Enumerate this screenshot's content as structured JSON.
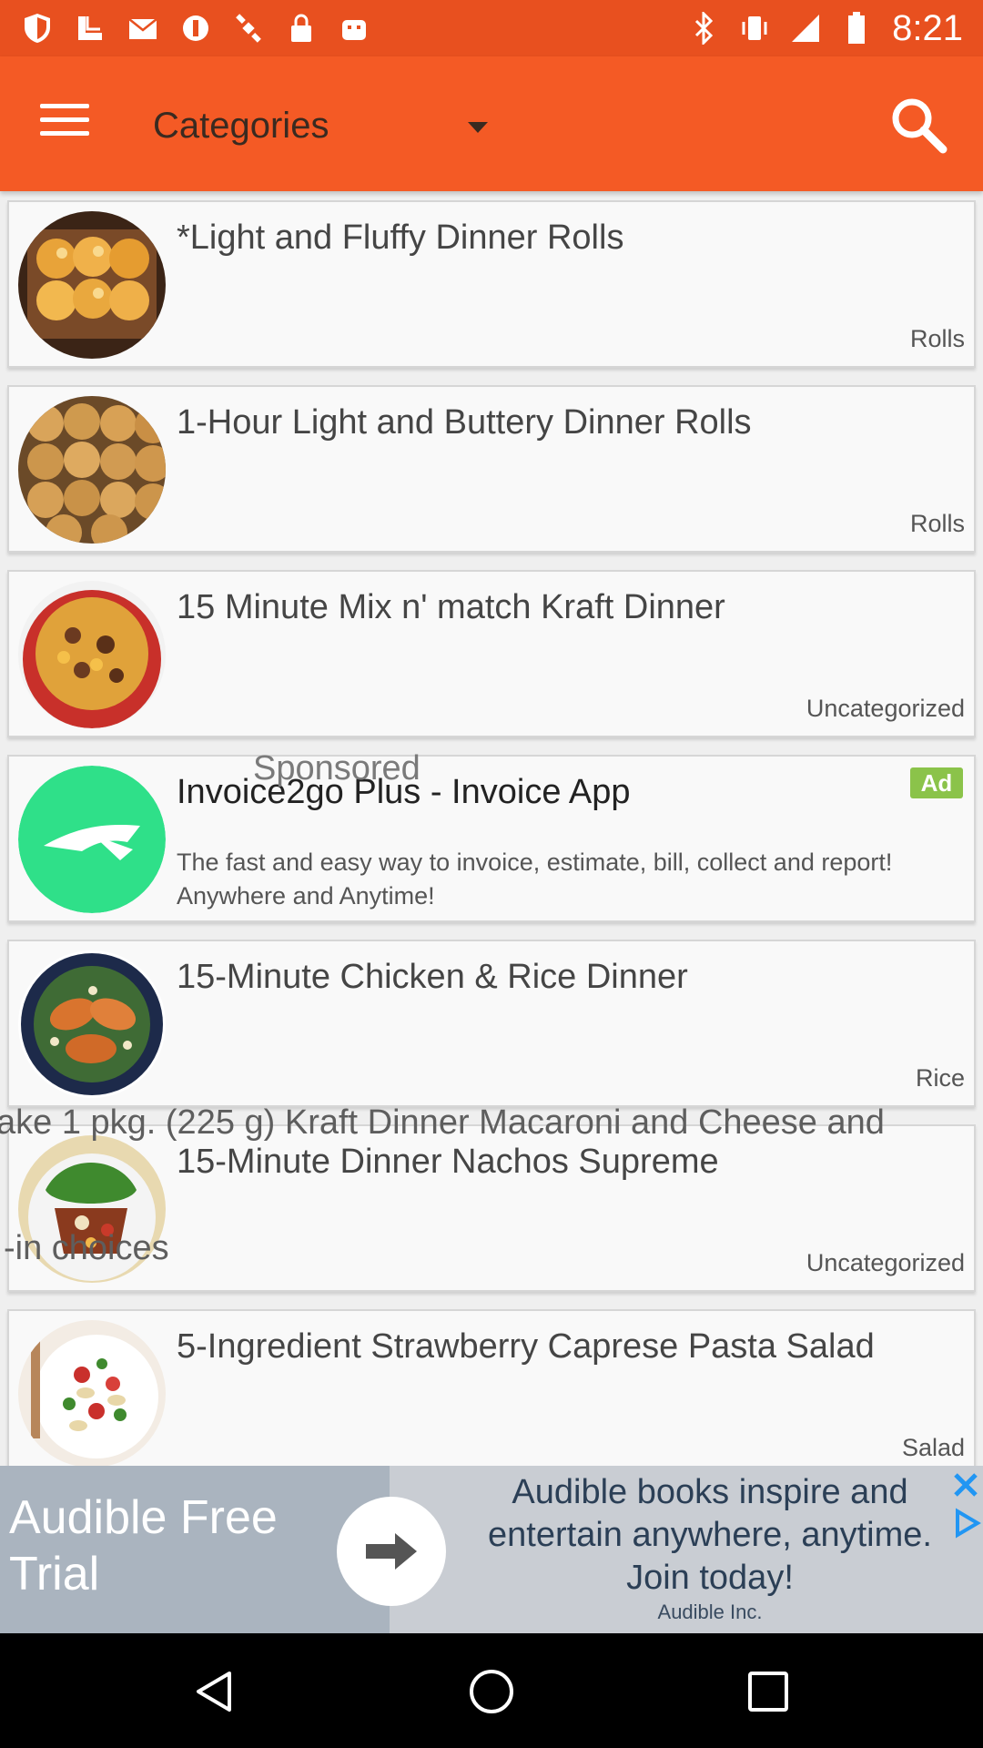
{
  "status_bar": {
    "time": "8:21",
    "left_icons": [
      "shield-icon",
      "download-icon",
      "mail-icon",
      "block-icon",
      "satellite-icon",
      "lock-icon",
      "android-icon"
    ],
    "right_icons": [
      "bluetooth-icon",
      "vibrate-icon",
      "signal-icon",
      "battery-icon"
    ]
  },
  "appbar": {
    "category_label": "Categories",
    "colors": {
      "status": "#e8501f",
      "bar": "#f45a25"
    }
  },
  "recipes": [
    {
      "title": "*Light and Fluffy Dinner Rolls",
      "category": "Rolls",
      "thumb": "dinner-rolls-thumb"
    },
    {
      "title": "1-Hour Light and Buttery Dinner Rolls",
      "category": "Rolls",
      "thumb": "buttery-rolls-thumb"
    },
    {
      "title": "15 Minute Mix n' match Kraft Dinner",
      "category": "Uncategorized",
      "thumb": "kraft-dinner-thumb"
    },
    {
      "title": "15-Minute Chicken & Rice Dinner",
      "category": "Rice",
      "thumb": "chicken-rice-thumb"
    },
    {
      "title": "15-Minute Dinner Nachos Supreme",
      "category": "Uncategorized",
      "thumb": "nachos-thumb"
    },
    {
      "title": "5-Ingredient Strawberry Caprese Pasta Salad",
      "category": "Salad",
      "thumb": "pasta-salad-thumb"
    }
  ],
  "sponsored_card": {
    "sponsored_label": "Sponsored",
    "title": "Invoice2go Plus - Invoice App",
    "badge": "Ad",
    "description": "The fast and easy way to invoice, estimate, bill, collect and report! Anywhere and Anytime!",
    "icon": "invoice2go-icon"
  },
  "overlay_texts": {
    "line1": "ake 1 pkg. (225 g) Kraft Dinner Macaroni and Cheese and",
    "line2": "-in choices"
  },
  "bottom_ad": {
    "title": "Audible Free Trial",
    "text": "Audible books inspire and entertain anywhere, anytime. Join today!",
    "company": "Audible Inc."
  }
}
